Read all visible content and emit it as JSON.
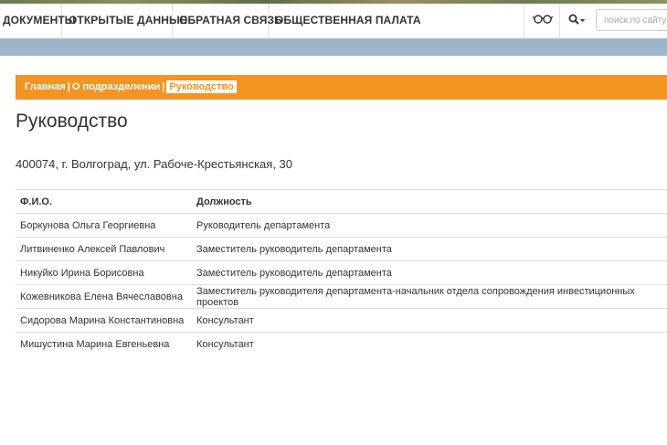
{
  "nav": {
    "items": [
      {
        "label": "ДОКУМЕНТЫ"
      },
      {
        "label": "ОТКРЫТЫЕ ДАННЫЕ"
      },
      {
        "label": "ОБРАТНАЯ СВЯЗЬ"
      },
      {
        "label": "ОБЩЕСТВЕННАЯ ПАЛАТА"
      }
    ],
    "glasses_icon": "glasses-icon",
    "search_icon": "search-icon",
    "search_placeholder": "поиск по сайту"
  },
  "colors": {
    "accent": "#f39423",
    "subheader_bar": "#9db5c8"
  },
  "breadcrumb": {
    "home": "Главная",
    "section": "О подразделении",
    "current": "Руководство",
    "separator": "|"
  },
  "page": {
    "title": "Руководство",
    "address": "400074, г. Волгоград, ул. Рабоче-Крестьянская, 30"
  },
  "table": {
    "headers": {
      "name": "Ф.И.О.",
      "position": "Должность"
    },
    "rows": [
      {
        "name": "Боркунова Ольга Георгиевна",
        "position": "Руководитель департамента"
      },
      {
        "name": "Литвиненко Алексей Павлович",
        "position": "Заместитель руководитель департамента"
      },
      {
        "name": "Никуйко Ирина Борисовна",
        "position": "Заместитель руководитель департамента"
      },
      {
        "name": "Кожевникова Елена Вячеславовна",
        "position": "Заместитель руководителя департамента-начальник отдела сопровождения инвестиционных проектов"
      },
      {
        "name": "Сидорова Марина Константиновна",
        "position": "Консультант"
      },
      {
        "name": "Мишустина Марина Евгеньевна",
        "position": "Консультант"
      }
    ]
  }
}
